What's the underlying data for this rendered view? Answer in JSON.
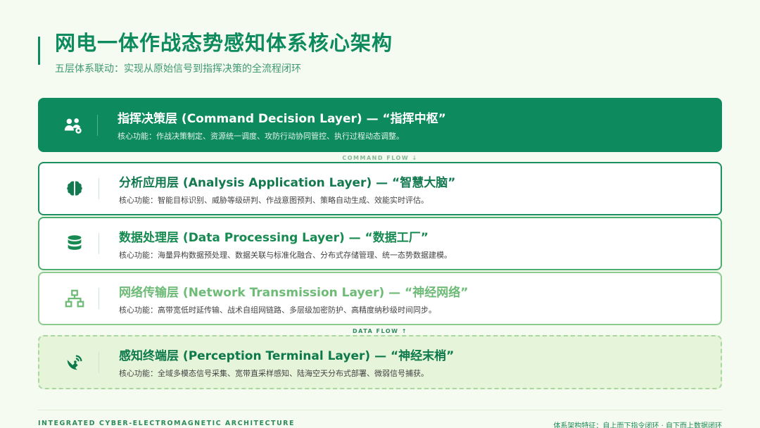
{
  "title": "网电一体作战态势感知体系核心架构",
  "subtitle": "五层体系联动：实现从原始信号到指挥决策的全流程闭环",
  "layers": [
    {
      "name": "指挥决策层 (Command Decision Layer) — “指挥中枢”",
      "desc": "核心功能：作战决策制定、资源统一调度、攻防行动协同管控、执行过程动态调整。",
      "icon": "users-gear-icon",
      "color": "#0e8a5f"
    },
    {
      "name": "分析应用层 (Analysis Application Layer) — “智慧大脑”",
      "desc": "核心功能：智能目标识别、威胁等级研判、作战意图预判、策略自动生成、效能实时评估。",
      "icon": "brain-icon",
      "color": "#137a50"
    },
    {
      "name": "数据处理层 (Data Processing Layer) — “数据工厂”",
      "desc": "核心功能：海量异构数据预处理、数据关联与标准化融合、分布式存储管理、统一态势数据建模。",
      "icon": "database-icon",
      "color": "#178a52"
    },
    {
      "name": "网络传输层 (Network Transmission Layer) — “神经网络”",
      "desc": "核心功能：高带宽低时延传输、战术自组网链路、多层级加密防护、高精度纳秒级时间同步。",
      "icon": "network-icon",
      "color": "#6dbb76"
    },
    {
      "name": "感知终端层 (Perception Terminal Layer) — “神经末梢”",
      "desc": "核心功能：全域多模态信号采集、宽带直采样感知、陆海空天分布式部署、微弱信号捕获。",
      "icon": "satellite-dish-icon",
      "color": "#0e7a4c"
    }
  ],
  "flows": {
    "command": "COMMAND FLOW ↓",
    "data": "DATA FLOW ↑"
  },
  "footer": {
    "left": "INTEGRATED CYBER-ELECTROMAGNETIC ARCHITECTURE",
    "right": "体系架构特征：自上而下指令闭环 · 自下而上数据闭环"
  }
}
